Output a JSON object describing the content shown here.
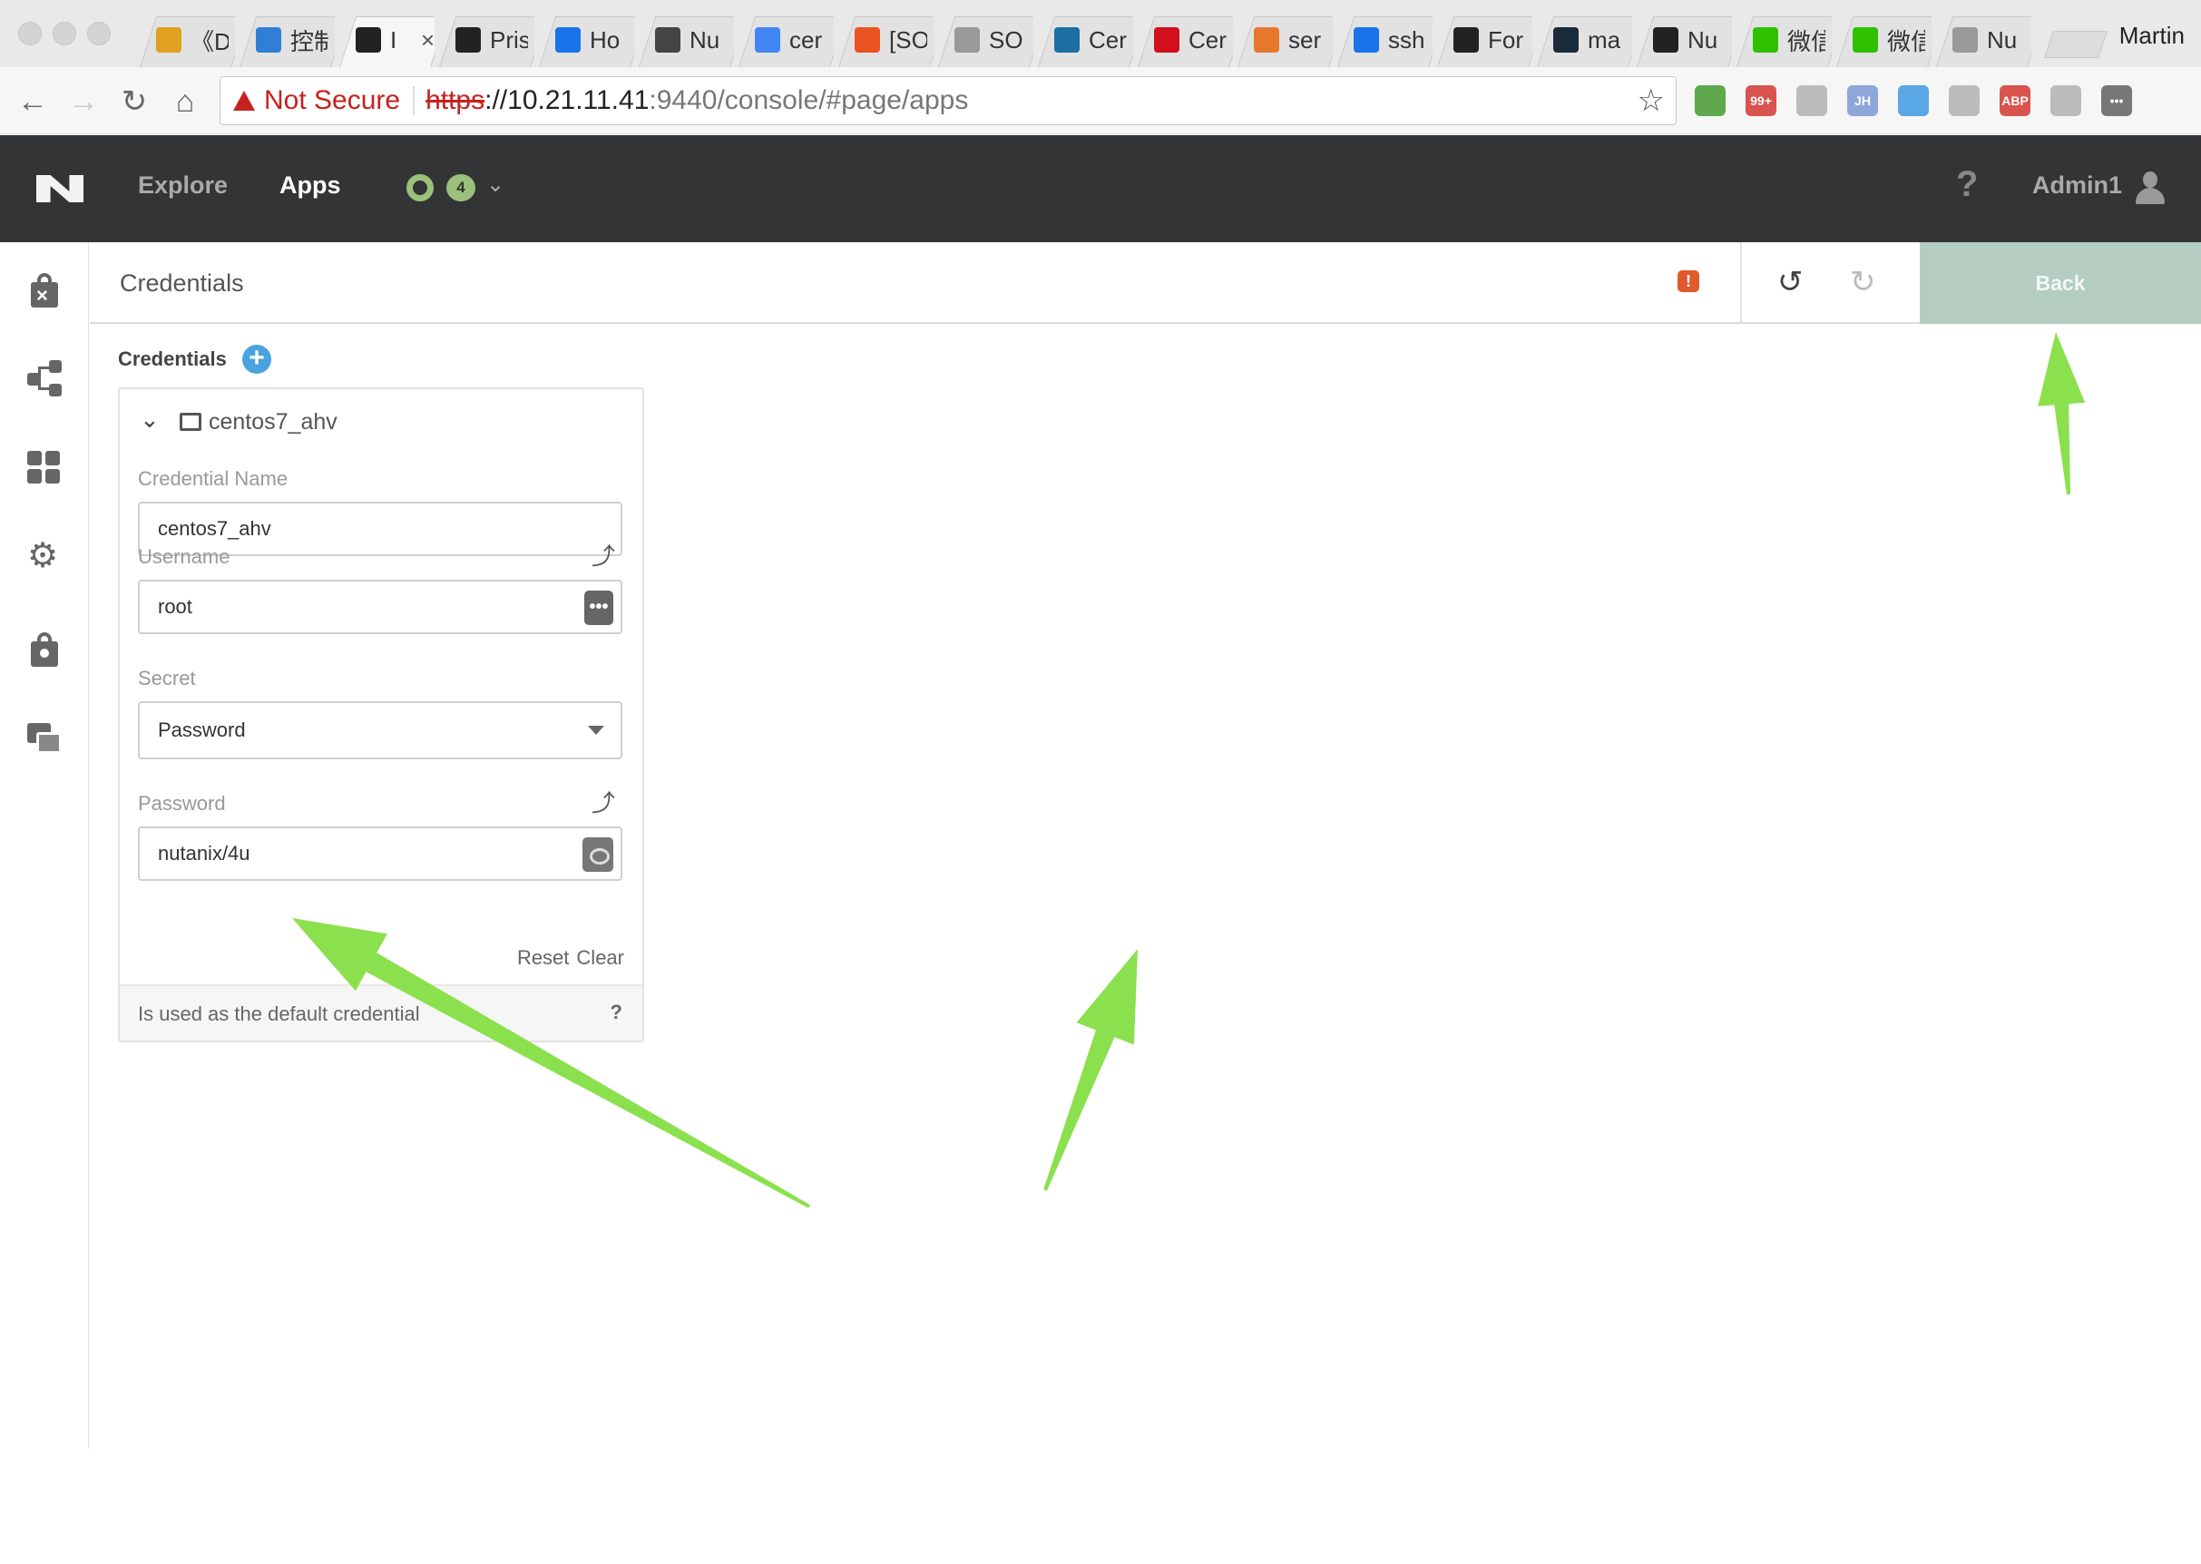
{
  "browser": {
    "profile_name": "Martin",
    "tabs": [
      {
        "title": "《D",
        "icon": "news-favicon",
        "color": "#e0a020"
      },
      {
        "title": "控制",
        "icon": "d-favicon",
        "color": "#2f7fd6"
      },
      {
        "title": "I",
        "icon": "nutanix-favicon",
        "color": "#222",
        "active": true
      },
      {
        "title": "Pris",
        "icon": "nutanix-favicon",
        "color": "#222"
      },
      {
        "title": "Ho",
        "icon": "digitalocean-favicon",
        "color": "#1a73e8"
      },
      {
        "title": "Nu",
        "icon": "globe-favicon",
        "color": "#444"
      },
      {
        "title": "cer",
        "icon": "google-favicon",
        "color": "#4285f4"
      },
      {
        "title": "[SO",
        "icon": "ubuntu-favicon",
        "color": "#e95420"
      },
      {
        "title": "SO",
        "icon": "document-favicon",
        "color": "#999"
      },
      {
        "title": "Cer",
        "icon": "code-favicon",
        "color": "#1c6ea4"
      },
      {
        "title": "Cer",
        "icon": "c-favicon",
        "color": "#d0101b"
      },
      {
        "title": "ser",
        "icon": "ask-favicon",
        "color": "#e8772e"
      },
      {
        "title": "ssh",
        "icon": "digitalocean-favicon",
        "color": "#1a73e8"
      },
      {
        "title": "For",
        "icon": "flag-favicon",
        "color": "#222"
      },
      {
        "title": "ma",
        "icon": "docker-favicon",
        "color": "#1a2b3c"
      },
      {
        "title": "Nu",
        "icon": "nutanix-favicon",
        "color": "#222"
      },
      {
        "title": "微信",
        "icon": "wechat-favicon",
        "color": "#2dc100"
      },
      {
        "title": "微信",
        "icon": "wechat-favicon",
        "color": "#2dc100"
      },
      {
        "title": "Nu",
        "icon": "document-favicon",
        "color": "#999"
      }
    ],
    "address": {
      "security_label": "Not Secure",
      "protocol": "https",
      "host": "://10.21.11.41",
      "path": ":9440/console/#page/apps"
    },
    "extensions": [
      {
        "icon": "drive-ext-icon",
        "color": "#5fa84b",
        "label": ""
      },
      {
        "icon": "mail-ext-icon",
        "color": "#d9534f",
        "label": "99+"
      },
      {
        "icon": "ext-icon",
        "color": "#bbb",
        "label": ""
      },
      {
        "icon": "jh-ext-icon",
        "color": "#8fa6d8",
        "label": "JH"
      },
      {
        "icon": "circle-ext-icon",
        "color": "#5aa7e6",
        "label": ""
      },
      {
        "icon": "square-ext-icon",
        "color": "#bbb",
        "label": ""
      },
      {
        "icon": "abp-ext-icon",
        "color": "#d9534f",
        "label": "ABP"
      },
      {
        "icon": "plane-ext-icon",
        "color": "#bbb",
        "label": ""
      },
      {
        "icon": "more-ext-icon",
        "color": "#777",
        "label": "•••"
      }
    ]
  },
  "app": {
    "nav": {
      "explore": "Explore",
      "apps": "Apps"
    },
    "status_count": "4",
    "help": "?",
    "user": "Admin1"
  },
  "page": {
    "title": "Credentials",
    "error_badge": "!",
    "back_label": "Back"
  },
  "credentials": {
    "heading": "Credentials",
    "add": "+",
    "item": {
      "name": "centos7_ahv",
      "credential_name_label": "Credential Name",
      "credential_name_value": "centos7_ahv",
      "username_label": "Username",
      "username_value": "root",
      "secret_label": "Secret",
      "secret_value": "Password",
      "password_label": "Password",
      "password_value": "nutanix/4u",
      "reset": "Reset",
      "clear": "Clear",
      "default_text": "Is used as the default credential",
      "help": "?"
    }
  },
  "colors": {
    "annotation_arrow": "#8be04e",
    "back_button": "#b4cdc0",
    "header": "#333435"
  }
}
